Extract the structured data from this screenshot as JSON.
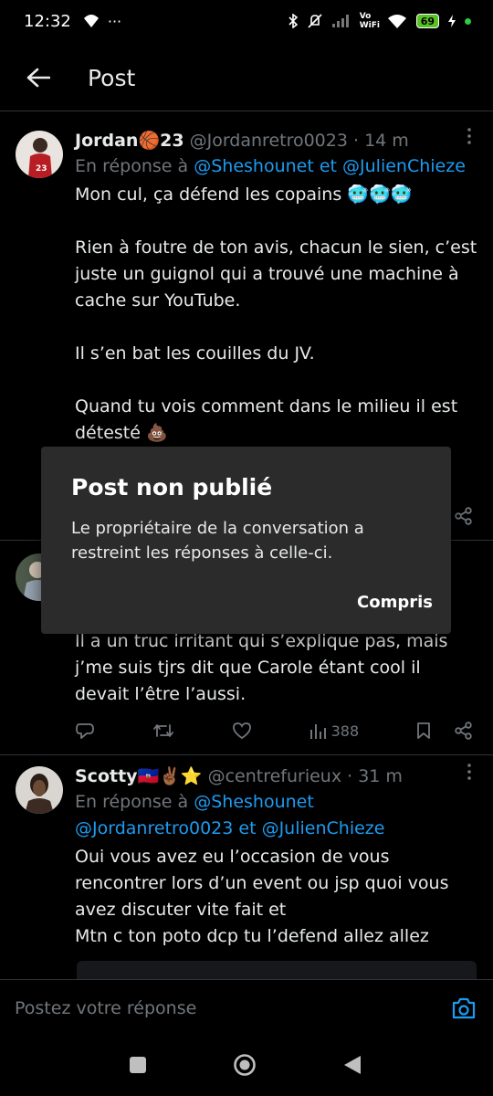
{
  "status_bar": {
    "time": "12:32",
    "wifi_label": "Vo WiFi",
    "battery": "69"
  },
  "header": {
    "title": "Post"
  },
  "tweets": [
    {
      "name": "Jordan🏀23",
      "handle": "@Jordanretro0023",
      "time": "· 14 m",
      "reply_prefix": "En réponse à",
      "reply_to": "@Sheshounet et @JulienChieze",
      "text": "Mon cul, ça défend les copains 🥶🥶🥶\n\nRien à foutre de ton avis, chacun le sien, c’est juste un guignol qui a trouvé une machine à cache sur YouTube.\n\nIl s’en bat les couilles du JV.\n\nQuand tu vois comment dans le milieu il est détesté 💩"
    },
    {
      "text": "Il a un truc irritant qui s’explique pas, mais j’me suis tjrs dit que Carole étant cool il devait l’être l’aussi.",
      "views": "388"
    },
    {
      "name": "Scotty🇭🇹✌🏾⭐",
      "handle": "@centrefurieux",
      "time": "· 31 m",
      "reply_prefix": "En réponse à",
      "reply_to_line1": "@Sheshounet",
      "reply_to_line2": "@Jordanretro0023 et @JulienChieze",
      "text": "Oui vous avez eu l’occasion de vous rencontrer lors d’un event ou jsp quoi vous avez discuter vite fait et\nMtn c ton poto dcp tu l’defend allez allez"
    }
  ],
  "dialog": {
    "title": "Post non publié",
    "message": "Le propriétaire de la conversation a restreint les réponses à celle-ci.",
    "button": "Compris"
  },
  "composer": {
    "placeholder": "Postez votre réponse"
  },
  "colors": {
    "accent": "#1d9bf0",
    "background": "#000000",
    "muted": "#71767b",
    "dialog": "#2b2b2b"
  },
  "icons": [
    "back-arrow-icon",
    "more-icon",
    "reply-icon",
    "retweet-icon",
    "like-icon",
    "views-icon",
    "bookmark-icon",
    "share-icon",
    "camera-icon",
    "nav-recents-icon",
    "nav-home-icon",
    "nav-back-icon"
  ]
}
